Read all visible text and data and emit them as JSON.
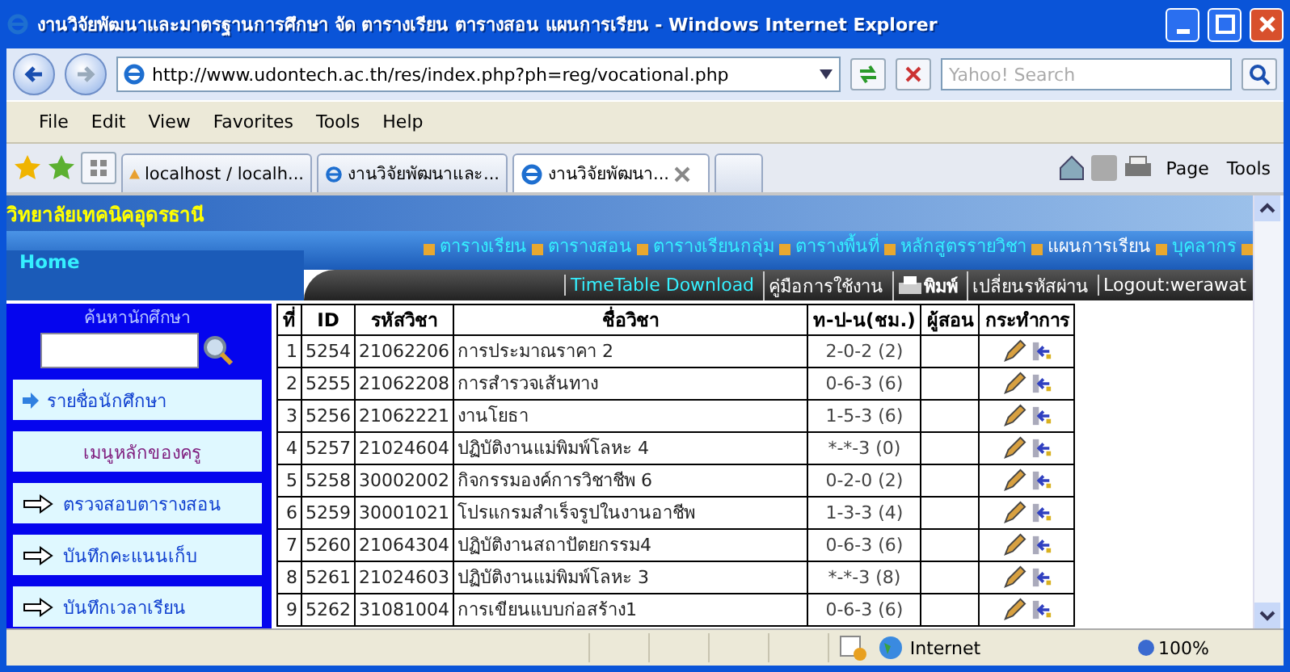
{
  "window": {
    "title": "งานวิจัยพัฒนาและมาตรฐานการศึกษา จัด ตารางเรียน ตารางสอน แผนการเรียน - Windows Internet Explorer"
  },
  "address_bar": {
    "url": "http://www.udontech.ac.th/res/index.php?ph=reg/vocational.php",
    "search_placeholder": "Yahoo! Search"
  },
  "menu": [
    "File",
    "Edit",
    "View",
    "Favorites",
    "Tools",
    "Help"
  ],
  "tabs": [
    {
      "label": "localhost / localh...",
      "selected": false,
      "kind": "pma"
    },
    {
      "label": "งานวิจัยพัฒนาและ...",
      "selected": false,
      "kind": "ie"
    },
    {
      "label": "งานวิจัยพัฒนา...",
      "selected": true,
      "kind": "ie"
    }
  ],
  "command_bar": [
    "Page",
    "Tools"
  ],
  "site": {
    "name": "วิทยาลัยเทคนิคอุดรธานี",
    "home": "Home",
    "nav": [
      "ตารางเรียน",
      "ตารางสอน",
      "ตารางเรียนกลุ่ม",
      "ตารางพื้นที่",
      "หลักสูตรรายวิชา",
      "แผนการเรียน",
      "บุคลากร"
    ],
    "links": [
      {
        "label": "TimeTable Download",
        "kind": "highlight"
      },
      {
        "label": "คู่มือการใช้งาน",
        "kind": "plain"
      },
      {
        "label": "พิมพ์",
        "kind": "print"
      },
      {
        "label": "เปลี่ยนรหัสผ่าน",
        "kind": "plain"
      },
      {
        "label": "Logout:werawat",
        "kind": "plain"
      }
    ]
  },
  "sidebar": {
    "search_label": "ค้นหานักศึกษา",
    "items": [
      {
        "label": "รายชื่อนักศึกษา",
        "kind": "link"
      },
      {
        "label": "เมนูหลักของครู",
        "kind": "heading"
      },
      {
        "label": "ตรวจสอบตารางสอน",
        "kind": "arrow"
      },
      {
        "label": "บันทึกคะแนนเก็บ",
        "kind": "arrow"
      },
      {
        "label": "บันทึกเวลาเรียน",
        "kind": "arrow"
      }
    ]
  },
  "table": {
    "columns": [
      "ที่",
      "ID",
      "รหัสวิชา",
      "ชื่อวิชา",
      "ท-ป-น(ชม.)",
      "ผู้สอน",
      "กระทำการ"
    ],
    "rows": [
      [
        "1",
        "5254",
        "21062206",
        "การประมาณราคา 2",
        "2-0-2 (2)"
      ],
      [
        "2",
        "5255",
        "21062208",
        "การสำรวจเส้นทาง",
        "0-6-3 (6)"
      ],
      [
        "3",
        "5256",
        "21062221",
        "งานโยธา",
        "1-5-3 (6)"
      ],
      [
        "4",
        "5257",
        "21024604",
        "ปฏิบัติงานแม่พิมพ์โลหะ 4",
        "*-*-3 (0)"
      ],
      [
        "5",
        "5258",
        "30002002",
        "กิจกรรมองค์การวิชาชีพ 6",
        "0-2-0 (2)"
      ],
      [
        "6",
        "5259",
        "30001021",
        "โปรแกรมสำเร็จรูปในงานอาชีพ",
        "1-3-3 (4)"
      ],
      [
        "7",
        "5260",
        "21064304",
        "ปฏิบัติงานสถาปัตยกรรม4",
        "0-6-3 (6)"
      ],
      [
        "8",
        "5261",
        "21024603",
        "ปฏิบัติงานแม่พิมพ์โลหะ 3",
        "*-*-3 (8)"
      ],
      [
        "9",
        "5262",
        "31081004",
        "การเขียนแบบก่อสร้าง1",
        "0-6-3 (6)"
      ]
    ]
  },
  "status_bar": {
    "zone": "Internet",
    "zoom": "100%"
  }
}
